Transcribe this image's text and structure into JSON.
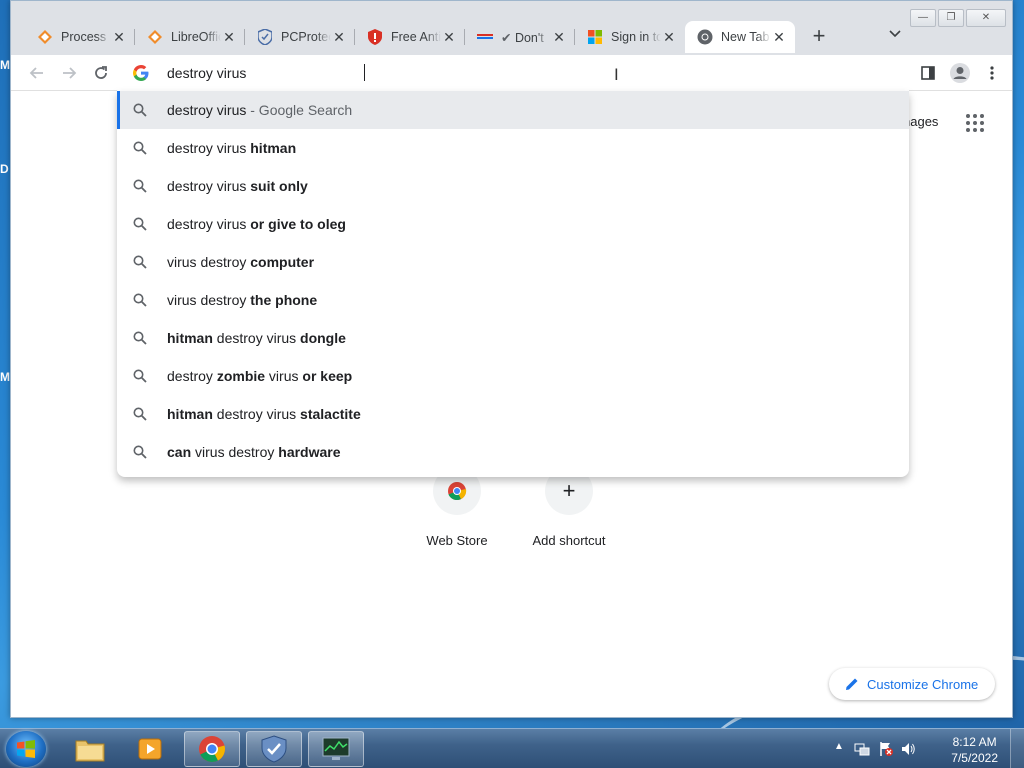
{
  "desktop": {
    "left_labels": [
      "M",
      "D",
      "M"
    ]
  },
  "window": {
    "controls": {
      "minimize": "—",
      "restore": "❐",
      "close": "✕"
    }
  },
  "tabs": [
    {
      "title": "Process Monitor",
      "icon": "sysinternals-icon",
      "active": false
    },
    {
      "title": "LibreOffice",
      "icon": "libreoffice-icon",
      "active": false
    },
    {
      "title": "PCProtect",
      "icon": "shield-check-icon",
      "active": false
    },
    {
      "title": "Free Antivirus",
      "icon": "red-shield-icon",
      "active": false
    },
    {
      "title": "Don't",
      "icon": "checkmark-icon",
      "active": false
    },
    {
      "title": "Sign in to",
      "icon": "microsoft-logo-icon",
      "active": false
    },
    {
      "title": "New Tab",
      "icon": "chrome-icon",
      "active": true
    }
  ],
  "tabstrip": {
    "new_tab_label": "+",
    "tab_search_icon": "chevron-down-icon"
  },
  "omnibox": {
    "value": "destroy virus ",
    "icon": "google-g-icon"
  },
  "suggestions": [
    {
      "parts": [
        {
          "t": "destroy virus",
          "b": false
        },
        {
          "t": " - Google Search",
          "b": false,
          "hint": true
        }
      ],
      "selected": true
    },
    {
      "parts": [
        {
          "t": "destroy virus ",
          "b": false
        },
        {
          "t": "hitman",
          "b": true
        }
      ]
    },
    {
      "parts": [
        {
          "t": "destroy virus ",
          "b": false
        },
        {
          "t": "suit only",
          "b": true
        }
      ]
    },
    {
      "parts": [
        {
          "t": "destroy virus ",
          "b": false
        },
        {
          "t": "or give to oleg",
          "b": true
        }
      ]
    },
    {
      "parts": [
        {
          "t": "virus destroy ",
          "b": false
        },
        {
          "t": "computer",
          "b": true
        }
      ]
    },
    {
      "parts": [
        {
          "t": "virus destroy ",
          "b": false
        },
        {
          "t": "the phone",
          "b": true
        }
      ]
    },
    {
      "parts": [
        {
          "t": "hitman",
          "b": true
        },
        {
          "t": " destroy virus ",
          "b": false
        },
        {
          "t": "dongle",
          "b": true
        }
      ]
    },
    {
      "parts": [
        {
          "t": "destroy ",
          "b": false
        },
        {
          "t": "zombie",
          "b": true
        },
        {
          "t": " virus ",
          "b": false
        },
        {
          "t": "or keep",
          "b": true
        }
      ]
    },
    {
      "parts": [
        {
          "t": "hitman",
          "b": true
        },
        {
          "t": " destroy virus ",
          "b": false
        },
        {
          "t": "stalactite",
          "b": true
        }
      ]
    },
    {
      "parts": [
        {
          "t": "can",
          "b": true
        },
        {
          "t": " virus destroy ",
          "b": false
        },
        {
          "t": "hardware",
          "b": true
        }
      ]
    }
  ],
  "ntp": {
    "images_link": "nages",
    "shortcuts": [
      {
        "label": "Web Store",
        "icon": "chrome-web-store-icon"
      },
      {
        "label": "Add shortcut",
        "icon": "plus-icon"
      }
    ],
    "customize_label": "Customize Chrome"
  },
  "taskbar": {
    "apps": [
      {
        "name": "file-explorer",
        "open": false
      },
      {
        "name": "media-player",
        "open": false
      },
      {
        "name": "chrome",
        "open": true
      },
      {
        "name": "security-shield",
        "open": true
      },
      {
        "name": "task-manager",
        "open": true
      }
    ],
    "tray": {
      "time": "8:12 AM",
      "date": "7/5/2022",
      "show_hidden": "▲"
    }
  },
  "colors": {
    "accent": "#1a73e8",
    "tabstrip": "#dee1e6",
    "selected_row": "#e8eaed"
  }
}
